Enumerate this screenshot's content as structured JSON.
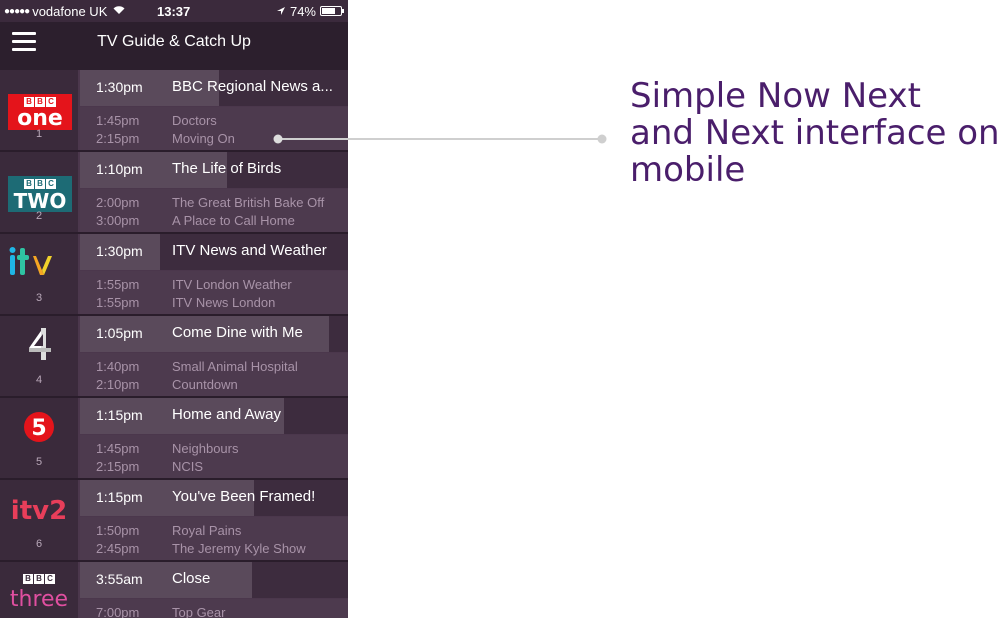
{
  "status_bar": {
    "carrier": "vodafone UK",
    "time": "13:37",
    "battery": "74%",
    "battery_level": 0.74
  },
  "header": {
    "title": "TV Guide & Catch Up"
  },
  "channels": [
    {
      "number": "1",
      "logo": "BBC One",
      "now": {
        "time": "1:30pm",
        "title": "BBC Regional News a...",
        "progress": 0.52
      },
      "next": [
        {
          "time": "1:45pm",
          "title": "Doctors"
        },
        {
          "time": "2:15pm",
          "title": "Moving On"
        }
      ]
    },
    {
      "number": "2",
      "logo": "BBC Two",
      "now": {
        "time": "1:10pm",
        "title": "The Life of Birds",
        "progress": 0.55
      },
      "next": [
        {
          "time": "2:00pm",
          "title": "The Great British Bake Off"
        },
        {
          "time": "3:00pm",
          "title": "A Place to Call Home"
        }
      ]
    },
    {
      "number": "3",
      "logo": "ITV",
      "now": {
        "time": "1:30pm",
        "title": "ITV News and Weather",
        "progress": 0.3
      },
      "next": [
        {
          "time": "1:55pm",
          "title": "ITV London Weather"
        },
        {
          "time": "1:55pm",
          "title": "ITV News London"
        }
      ]
    },
    {
      "number": "4",
      "logo": "Channel 4",
      "now": {
        "time": "1:05pm",
        "title": "Come Dine with Me",
        "progress": 0.93
      },
      "next": [
        {
          "time": "1:40pm",
          "title": "Small Animal Hospital"
        },
        {
          "time": "2:10pm",
          "title": "Countdown"
        }
      ]
    },
    {
      "number": "5",
      "logo": "Channel 5",
      "now": {
        "time": "1:15pm",
        "title": "Home and Away",
        "progress": 0.76
      },
      "next": [
        {
          "time": "1:45pm",
          "title": "Neighbours"
        },
        {
          "time": "2:15pm",
          "title": "NCIS"
        }
      ]
    },
    {
      "number": "6",
      "logo": "ITV2",
      "now": {
        "time": "1:15pm",
        "title": "You've Been Framed!",
        "progress": 0.65
      },
      "next": [
        {
          "time": "1:50pm",
          "title": "Royal Pains"
        },
        {
          "time": "2:45pm",
          "title": "The Jeremy Kyle Show"
        }
      ]
    },
    {
      "number": "",
      "logo": "BBC Three",
      "now": {
        "time": "3:55am",
        "title": "Close",
        "progress": 0.64
      },
      "next": [
        {
          "time": "7:00pm",
          "title": "Top Gear"
        },
        {
          "time": "",
          "title": ""
        }
      ]
    }
  ],
  "annotation": {
    "lines": [
      "Simple Now Next",
      "and Next interface on",
      "mobile"
    ]
  },
  "colors": {
    "annotation_text": "#4a1e6b",
    "bbc_one_red": "#e4141b",
    "bbc_two_teal": "#1d6b75",
    "connector": "#cfcfcf"
  }
}
